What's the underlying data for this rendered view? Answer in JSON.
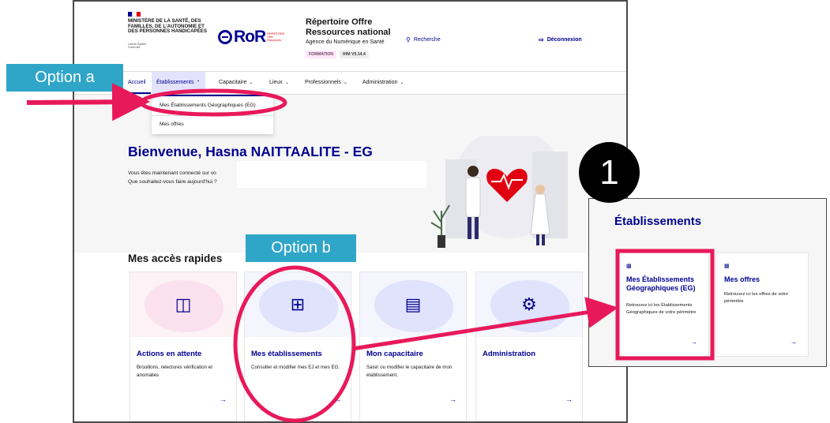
{
  "header": {
    "ministry": "MINISTÈRE DE LA SANTÉ, DES FAMILLES, DE L'AUTONOMIE ET DES PERSONNES HANDICAPÉES",
    "motto": "Liberté Égalité Fraternité",
    "ror_logo": "RoR",
    "ror_logo_sub": "RÉPERTOIRE Offre Ressources",
    "app_title": "Répertoire Offre Ressources national",
    "app_subtitle": "Agence du Numérique en Santé",
    "badge_formation": "FORMATION",
    "badge_version": "IHM V5.14.4",
    "search_label": "Recherche",
    "logout_label": "Déconnexion"
  },
  "nav": {
    "items": [
      {
        "label": "Accueil"
      },
      {
        "label": "Établissements"
      },
      {
        "label": "Capacitaire"
      },
      {
        "label": "Lieux"
      },
      {
        "label": "Professionnels"
      },
      {
        "label": "Administration"
      }
    ]
  },
  "dropdown": {
    "items": [
      {
        "label": "Mes Établissements Géographiques (EG)"
      },
      {
        "label": "Mes offres"
      }
    ]
  },
  "hero": {
    "welcome": "Bienvenue, Hasna NAITTAALITE - EG",
    "line1": "Vous êtes maintenant connecté sur vo",
    "line2": "Que souhaitez-vous faire aujourd'hui ?"
  },
  "quick_access": {
    "title": "Mes accès rapides",
    "cards": [
      {
        "title": "Actions en attente",
        "desc": "Brouillons, relectures vérification et anomalies",
        "icon": "table-icon"
      },
      {
        "title": "Mes établissements",
        "desc": "Consulter et modifier mes EJ et mes EG.",
        "icon": "hospital-icon"
      },
      {
        "title": "Mon capacitaire",
        "desc": "Saisir ou modifier le capacitaire de mon établissement.",
        "icon": "bed-icon"
      },
      {
        "title": "Administration",
        "desc": "",
        "icon": "gear-icon"
      }
    ]
  },
  "annotations": {
    "option_a": "Option a",
    "option_b": "Option b",
    "step_number": "1",
    "highlight_color": "#e8195a",
    "tag_color": "#2fa6c8"
  },
  "establishments_panel": {
    "title": "Établissements",
    "cards": [
      {
        "title": "Mes Établissements Géographiques (EG)",
        "desc": "Retrouvez ici les Établissements Géographiques de votre périmètre"
      },
      {
        "title": "Mes offres",
        "desc": "Retrouvez ici les offres de votre périmètre"
      }
    ]
  },
  "colors": {
    "primary": "#000091",
    "marianne_red": "#e1000f"
  }
}
